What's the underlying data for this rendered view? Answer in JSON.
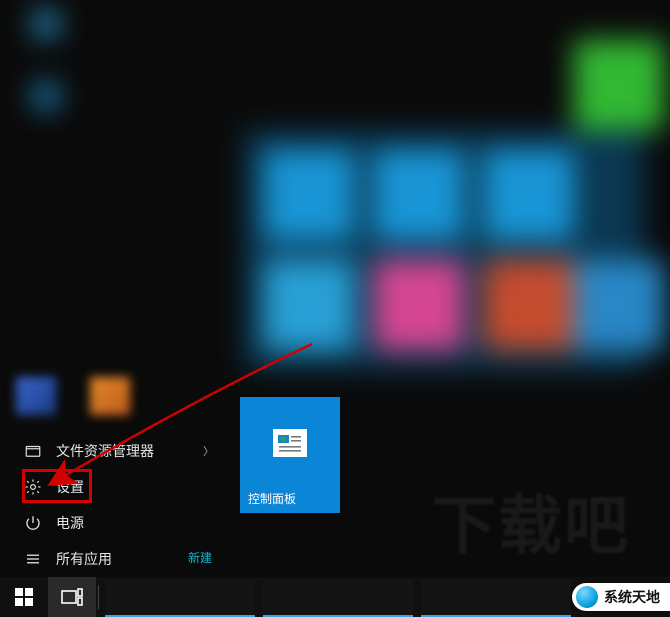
{
  "left_menu": {
    "file_explorer": "文件资源管理器",
    "settings": "设置",
    "power": "电源",
    "all_apps": "所有应用"
  },
  "tile_group_label": "新建",
  "pinned_tile": {
    "label": "控制面板"
  },
  "watermark_text": "下载吧",
  "badge_text": "系统天地",
  "colors": {
    "tile_blue": "#0b85d6",
    "highlight_red": "#d30000",
    "accent": "#15b3c9"
  }
}
